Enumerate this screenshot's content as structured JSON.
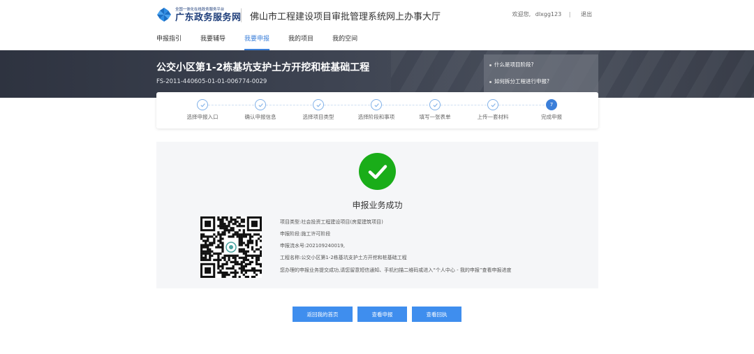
{
  "header": {
    "logo_small": "全国一体化在线政务服务平台",
    "logo_big": "广东政务服务网",
    "site_title": "佛山市工程建设项目审批管理系统网上办事大厅",
    "welcome": "欢迎您,",
    "username": "dlxgg123",
    "separator": "|",
    "logout": "退出"
  },
  "nav": [
    {
      "label": "申报指引"
    },
    {
      "label": "我要辅导"
    },
    {
      "label": "我要申报",
      "active": true
    },
    {
      "label": "我的项目"
    },
    {
      "label": "我的空间"
    }
  ],
  "banner": {
    "project_name": "公交小区第1-2栋基坑支护土方开挖和桩基础工程",
    "project_code": "FS-2011-440605-01-01-006774-0029",
    "help_links": [
      "什么是项目阶段?",
      "如何拆分工程进行申报?"
    ]
  },
  "steps": [
    {
      "label": "选择申报入口",
      "done": true
    },
    {
      "label": "确认申报信息",
      "done": true
    },
    {
      "label": "选择项目类型",
      "done": true
    },
    {
      "label": "选择阶段和事项",
      "done": true
    },
    {
      "label": "填写一张表单",
      "done": true
    },
    {
      "label": "上传一套材料",
      "done": true
    },
    {
      "label": "完成申报",
      "number": "7",
      "current": true
    }
  ],
  "result": {
    "title": "申报业务成功",
    "project_type": "项目类型:社会投资工程建设项目(房屋建筑项目)",
    "stage": "申报阶段:施工许可阶段",
    "serial": "申报流水号:202109240019,",
    "project": "工程名称:公交小区第1-2栋基坑支护土方开挖和桩基础工程",
    "tip": "您办理的申报业务提交成功,请您留意短信通知、手机扫描二维码或进入“个人中心 - 我的申报”查看申报进度"
  },
  "buttons": {
    "home": "返回我的首页",
    "view": "查看申报",
    "receipt": "查看回执"
  },
  "colors": {
    "accent": "#3b7fd9",
    "button": "#3f8eee",
    "success": "#1aad19",
    "brand": "#1d3d7a"
  }
}
